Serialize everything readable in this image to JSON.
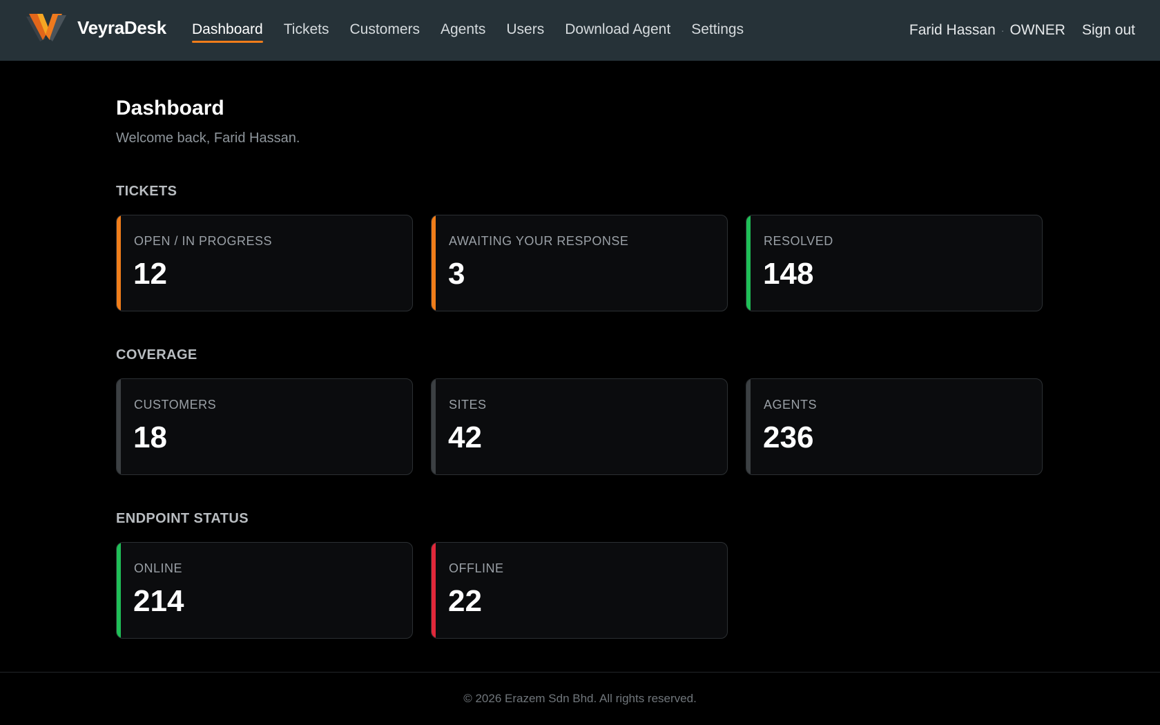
{
  "app": {
    "name": "VeyraDesk"
  },
  "nav": {
    "items": [
      {
        "label": "Dashboard",
        "active": true
      },
      {
        "label": "Tickets"
      },
      {
        "label": "Customers"
      },
      {
        "label": "Agents"
      },
      {
        "label": "Users"
      },
      {
        "label": "Download Agent"
      },
      {
        "label": "Settings"
      }
    ]
  },
  "user": {
    "name": "Farid Hassan",
    "separator": "·",
    "role": "OWNER",
    "signout_label": "Sign out"
  },
  "page": {
    "title": "Dashboard",
    "welcome": "Welcome back, Farid Hassan."
  },
  "sections": {
    "tickets": {
      "title": "TICKETS",
      "cards": [
        {
          "label": "OPEN / IN PROGRESS",
          "value": "12",
          "accent": "#f07d1a"
        },
        {
          "label": "AWAITING YOUR RESPONSE",
          "value": "3",
          "accent": "#f07d1a"
        },
        {
          "label": "RESOLVED",
          "value": "148",
          "accent": "#1fbf57"
        }
      ]
    },
    "coverage": {
      "title": "COVERAGE",
      "cards": [
        {
          "label": "CUSTOMERS",
          "value": "18",
          "accent": "#3c4043"
        },
        {
          "label": "SITES",
          "value": "42",
          "accent": "#3c4043"
        },
        {
          "label": "AGENTS",
          "value": "236",
          "accent": "#3c4043"
        }
      ]
    },
    "endpoint_status": {
      "title": "ENDPOINT STATUS",
      "cards": [
        {
          "label": "ONLINE",
          "value": "214",
          "accent": "#1fbf57"
        },
        {
          "label": "OFFLINE",
          "value": "22",
          "accent": "#e0283a"
        }
      ]
    }
  },
  "footer": {
    "text": "© 2026 Erazem Sdn Bhd. All rights reserved."
  },
  "colors": {
    "topbar": "#263238",
    "background": "#000000",
    "nav_active_underline": "#f07d1a",
    "card_bg": "#0b0c0e"
  },
  "icons": {
    "logo": "veyradesk-v-logo-icon"
  }
}
